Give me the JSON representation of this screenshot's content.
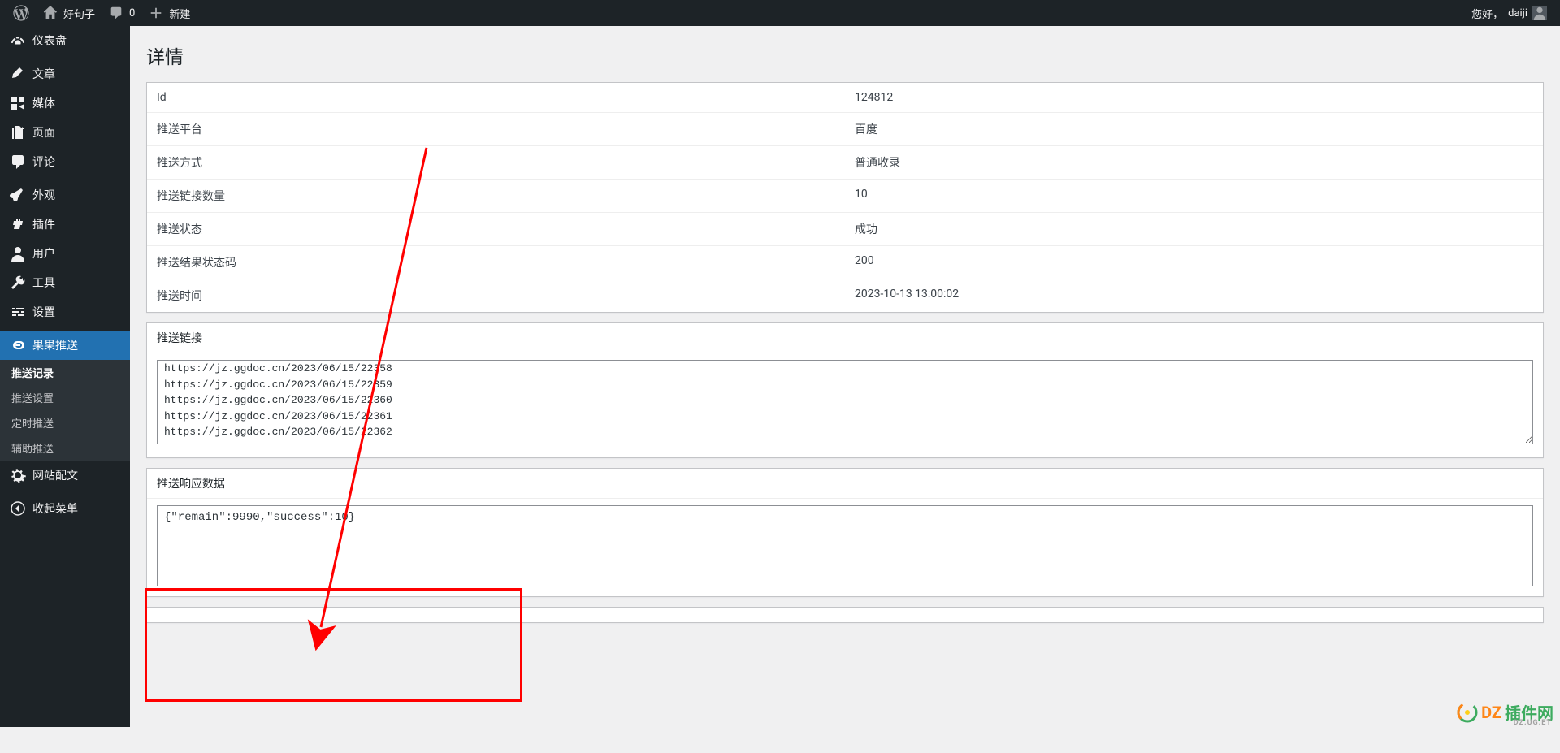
{
  "adminbar": {
    "site_name": "好句子",
    "comments_count": "0",
    "new_label": "新建",
    "greeting": "您好，",
    "username": "daiji"
  },
  "sidebar": {
    "items": [
      {
        "icon": "dashboard",
        "label": "仪表盘"
      },
      {
        "icon": "post",
        "label": "文章"
      },
      {
        "icon": "media",
        "label": "媒体"
      },
      {
        "icon": "page",
        "label": "页面"
      },
      {
        "icon": "comment",
        "label": "评论"
      },
      {
        "icon": "appearance",
        "label": "外观"
      },
      {
        "icon": "plugin",
        "label": "插件"
      },
      {
        "icon": "user",
        "label": "用户"
      },
      {
        "icon": "tool",
        "label": "工具"
      },
      {
        "icon": "setting",
        "label": "设置"
      },
      {
        "icon": "link",
        "label": "果果推送"
      },
      {
        "icon": "admin",
        "label": "网站配文"
      },
      {
        "icon": "collapse",
        "label": "收起菜单"
      }
    ],
    "submenu": [
      "推送记录",
      "推送设置",
      "定时推送",
      "辅助推送"
    ]
  },
  "page": {
    "title": "详情",
    "details": [
      {
        "label": "Id",
        "value": "124812"
      },
      {
        "label": "推送平台",
        "value": "百度"
      },
      {
        "label": "推送方式",
        "value": "普通收录"
      },
      {
        "label": "推送链接数量",
        "value": "10"
      },
      {
        "label": "推送状态",
        "value": "成功"
      },
      {
        "label": "推送结果状态码",
        "value": "200"
      },
      {
        "label": "推送时间",
        "value": "2023-10-13 13:00:02"
      }
    ],
    "links_panel_title": "推送链接",
    "links_text": "https://jz.ggdoc.cn/2023/06/15/22358\nhttps://jz.ggdoc.cn/2023/06/15/22359\nhttps://jz.ggdoc.cn/2023/06/15/22360\nhttps://jz.ggdoc.cn/2023/06/15/22361\nhttps://jz.ggdoc.cn/2023/06/15/22362",
    "response_panel_title": "推送响应数据",
    "response_text": "{\"remain\":9990,\"success\":10}"
  },
  "watermark": {
    "text1": "DZ",
    "text2": "插件网",
    "sub": "DZ.UG.ET"
  }
}
